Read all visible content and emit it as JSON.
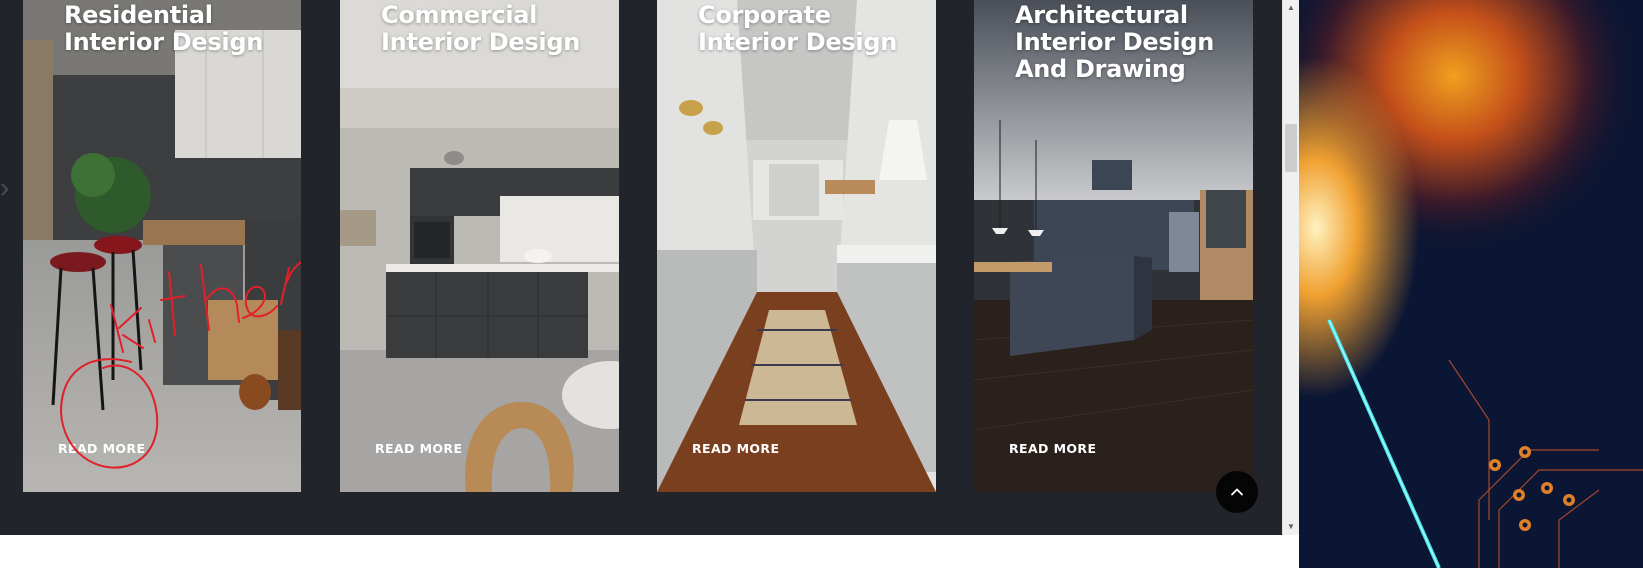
{
  "cards": [
    {
      "title_line1": "Residential",
      "title_line2": "Interior Design",
      "title_line3": "",
      "link": "READ MORE",
      "photo": "kitchen-photo-dark-concrete"
    },
    {
      "title_line1": "Commercial",
      "title_line2": "Interior Design",
      "title_line3": "",
      "link": "READ MORE",
      "photo": "kitchen-photo-grey-cabinets"
    },
    {
      "title_line1": "Corporate",
      "title_line2": "Interior Design",
      "title_line3": "",
      "link": "READ MORE",
      "photo": "kitchen-photo-white-cabinets"
    },
    {
      "title_line1": "Architectural",
      "title_line2": "Interior Design",
      "title_line3": "And Drawing",
      "link": "READ MORE",
      "photo": "kitchen-photo-dark-wood"
    }
  ],
  "annotation": {
    "handwritten_text": "kitchen",
    "color": "#e0202a"
  },
  "scroll_top_icon": "chevron-up-icon",
  "colors": {
    "page_bg": "#22242b",
    "card_text": "#ffffff",
    "scroll_top_bg": "#050505",
    "scrollbar_bg": "#f0f0f0",
    "scrollbar_thumb": "#cdcdcd"
  }
}
